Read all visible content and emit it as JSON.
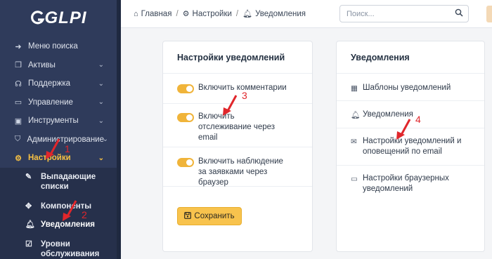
{
  "app": {
    "logo_text": "GLPI"
  },
  "sidebar": {
    "items": [
      {
        "label": "Меню поиска",
        "icon": "arrow-right-icon",
        "has_chevron": false
      },
      {
        "label": "Активы",
        "icon": "cube-icon",
        "has_chevron": true
      },
      {
        "label": "Поддержка",
        "icon": "headset-icon",
        "has_chevron": true
      },
      {
        "label": "Управление",
        "icon": "wallet-icon",
        "has_chevron": true
      },
      {
        "label": "Инструменты",
        "icon": "briefcase-icon",
        "has_chevron": true
      },
      {
        "label": "Администрирование",
        "icon": "shield-icon",
        "has_chevron": true
      },
      {
        "label": "Настройки",
        "icon": "gear-icon",
        "has_chevron": true,
        "active": true
      }
    ],
    "subitems": [
      {
        "label": "Выпадающие списки",
        "icon": "edit-icon"
      },
      {
        "label": "Компоненты",
        "icon": "puzzle-icon"
      },
      {
        "label": "Уведомления",
        "icon": "bell-icon",
        "current": true
      },
      {
        "label": "Уровни обслуживания",
        "icon": "checklist-icon"
      }
    ],
    "active_color": "#f7c143",
    "bg_color": "#2f3b5b"
  },
  "header": {
    "breadcrumb": [
      {
        "label": "Главная",
        "icon": "home-icon"
      },
      {
        "label": "Настройки",
        "icon": "gear-icon"
      },
      {
        "label": "Уведомления",
        "icon": "bell-icon"
      }
    ],
    "breadcrumb_separator": "/",
    "search": {
      "placeholder": "Поиск...",
      "value": ""
    }
  },
  "settings_card": {
    "title": "Настройки уведомлений",
    "options": [
      {
        "label": "Включить комментарии",
        "enabled": true
      },
      {
        "label": "Включить отслеживание через email",
        "enabled": true
      },
      {
        "label": "Включить наблюдение за заявками через браузер",
        "enabled": true
      }
    ],
    "save_label": "Сохранить",
    "accent_color": "#f8c34d"
  },
  "notifications_card": {
    "title": "Уведомления",
    "links": [
      {
        "label": "Шаблоны уведомлений",
        "icon": "template-icon"
      },
      {
        "label": "Уведомления",
        "icon": "bell-icon"
      },
      {
        "label": "Настройки уведомлений и оповещений по email",
        "icon": "envelope-icon"
      },
      {
        "label": "Настройки браузерных уведомлений",
        "icon": "monitor-icon"
      }
    ]
  },
  "annotations": {
    "color": "#e0262b",
    "numbers": [
      "1",
      "2",
      "3",
      "4"
    ]
  }
}
